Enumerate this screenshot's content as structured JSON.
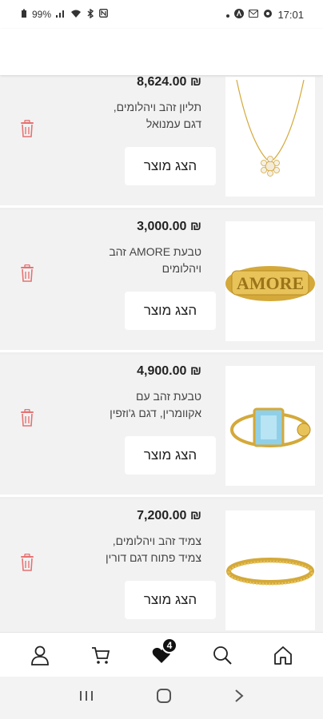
{
  "status_bar": {
    "battery": "99%",
    "time": "17:01"
  },
  "products": [
    {
      "price": "₪ 8,624.00",
      "title": "תליון זהב ויהלומים, דגם עמנואל",
      "view_label": "הצג מוצר",
      "image": "pendant-necklace"
    },
    {
      "price": "₪ 3,000.00",
      "title": "טבעת AMORE זהב ויהלומים",
      "view_label": "הצג מוצר",
      "image": "amore-ring"
    },
    {
      "price": "₪ 4,900.00",
      "title": "טבעת זהב עם אקוומרין, דגם ג'וזפין",
      "view_label": "הצג מוצר",
      "image": "aquamarine-ring"
    },
    {
      "price": "₪ 7,200.00",
      "title": "צמיד זהב ויהלומים, צמיד פתוח דגם דורין",
      "view_label": "הצג מוצר",
      "image": "open-bracelet"
    }
  ],
  "tabbar": {
    "items": [
      "profile",
      "cart",
      "wishlist",
      "search",
      "home"
    ],
    "wishlist_count": "4"
  },
  "colors": {
    "trash": "#e57373",
    "gold": "#d4a93a",
    "aquamarine": "#8fd0e8"
  }
}
